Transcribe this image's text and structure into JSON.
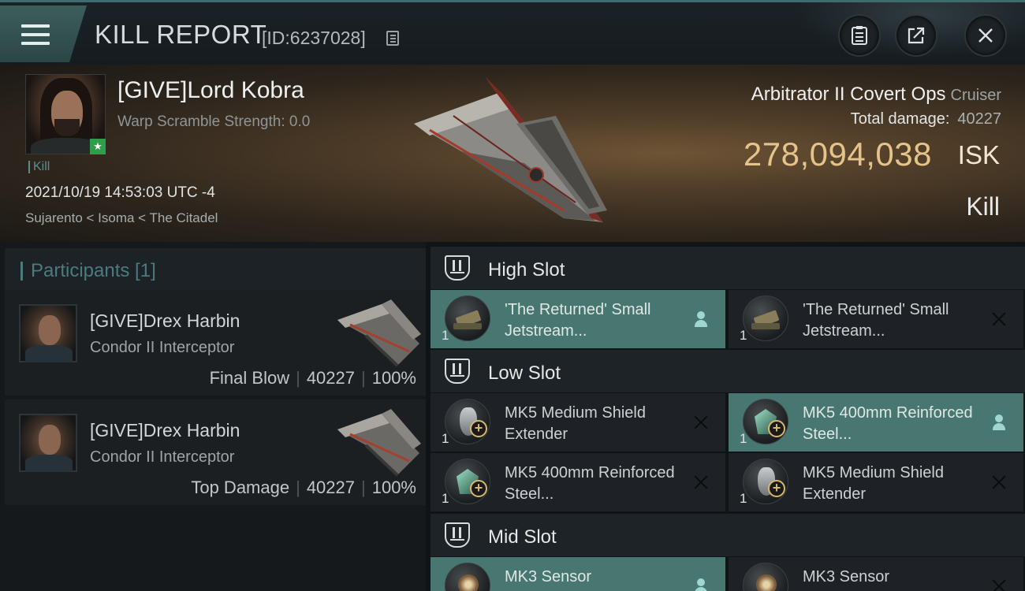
{
  "header": {
    "title": "KILL REPORT",
    "report_id": "[ID:6237028]"
  },
  "kill": {
    "pilot_name": "[GIVE]Lord Kobra",
    "warp_scramble": "Warp Scramble Strength: 0.0",
    "tag": "Kill",
    "datetime": "2021/10/19 14:53:03 UTC -4",
    "location": "Sujarento < Isoma < The Citadel",
    "ship_name": "Arbitrator II Covert Ops",
    "ship_class": "Cruiser",
    "total_damage_label": "Total damage:",
    "total_damage": "40227",
    "isk_value": "278,094,038",
    "isk_unit": "ISK",
    "kill_type": "Kill"
  },
  "participants": {
    "title": "Participants [1]",
    "rows": [
      {
        "name": "[GIVE]Drex Harbin",
        "ship": "Condor II Interceptor",
        "role": "Final Blow",
        "damage": "40227",
        "percent": "100%"
      },
      {
        "name": "[GIVE]Drex Harbin",
        "ship": "Condor II Interceptor",
        "role": "Top Damage",
        "damage": "40227",
        "percent": "100%"
      }
    ]
  },
  "fitting": {
    "high_slot": {
      "label": "High Slot",
      "modules": [
        {
          "name": "'The Returned' Small Jetstream...",
          "qty": "1",
          "state": "dropped"
        },
        {
          "name": "'The Returned' Small Jetstream...",
          "qty": "1",
          "state": "destroyed"
        }
      ]
    },
    "low_slot": {
      "label": "Low Slot",
      "modules": [
        {
          "name": "MK5 Medium Shield Extender",
          "qty": "1",
          "state": "destroyed"
        },
        {
          "name": "MK5 400mm Reinforced Steel...",
          "qty": "1",
          "state": "dropped"
        },
        {
          "name": "MK5 400mm Reinforced Steel...",
          "qty": "1",
          "state": "destroyed"
        },
        {
          "name": "MK5 Medium Shield Extender",
          "qty": "1",
          "state": "destroyed"
        }
      ]
    },
    "mid_slot": {
      "label": "Mid Slot",
      "modules": [
        {
          "name": "MK3 Sensor",
          "state": "dropped"
        },
        {
          "name": "MK3 Sensor",
          "state": "destroyed"
        }
      ]
    }
  },
  "icons": {
    "menu": "hamburger-icon",
    "copy": "copy-icon",
    "clipboard": "clipboard-icon",
    "share": "share-icon",
    "close": "close-icon",
    "dropped": "person-icon",
    "destroyed": "x-icon"
  },
  "colors": {
    "accent": "#487670",
    "isk": "#e5c48a",
    "participants_title": "#4d7a7d"
  }
}
